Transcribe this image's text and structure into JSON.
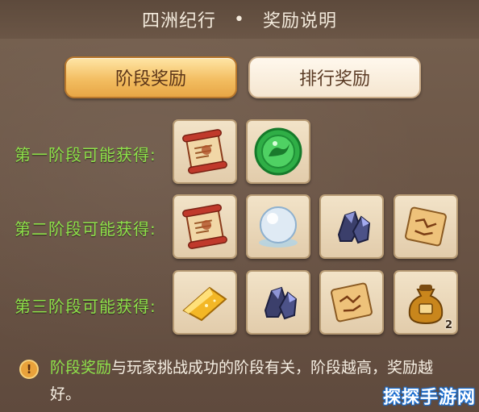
{
  "header": {
    "title_left": "四洲纪行",
    "separator": "•",
    "title_right": "奖励说明"
  },
  "tabs": [
    {
      "label": "阶段奖励",
      "active": true
    },
    {
      "label": "排行奖励",
      "active": false
    }
  ],
  "rows": [
    {
      "label": "第一阶段可能获得:",
      "items": [
        "scroll-icon",
        "jade-dragon-icon"
      ]
    },
    {
      "label": "第二阶段可能获得:",
      "items": [
        "scroll-icon",
        "pearl-icon",
        "dark-crystal-icon",
        "map-scroll-icon"
      ]
    },
    {
      "label": "第三阶段可能获得:",
      "items": [
        "gold-crystal-icon",
        "dark-crystal-icon",
        "map-scroll-icon",
        "pouch-icon"
      ]
    }
  ],
  "badges": {
    "pouch_count": "2"
  },
  "note": {
    "highlight": "阶段奖励",
    "text": "与玩家挑战成功的阶段有关，阶段越高，奖励越好。"
  },
  "watermark": "探探手游网",
  "colors": {
    "accent_green": "#8ee24a",
    "tab_active": "#f3be62",
    "background": "#6e5646"
  }
}
